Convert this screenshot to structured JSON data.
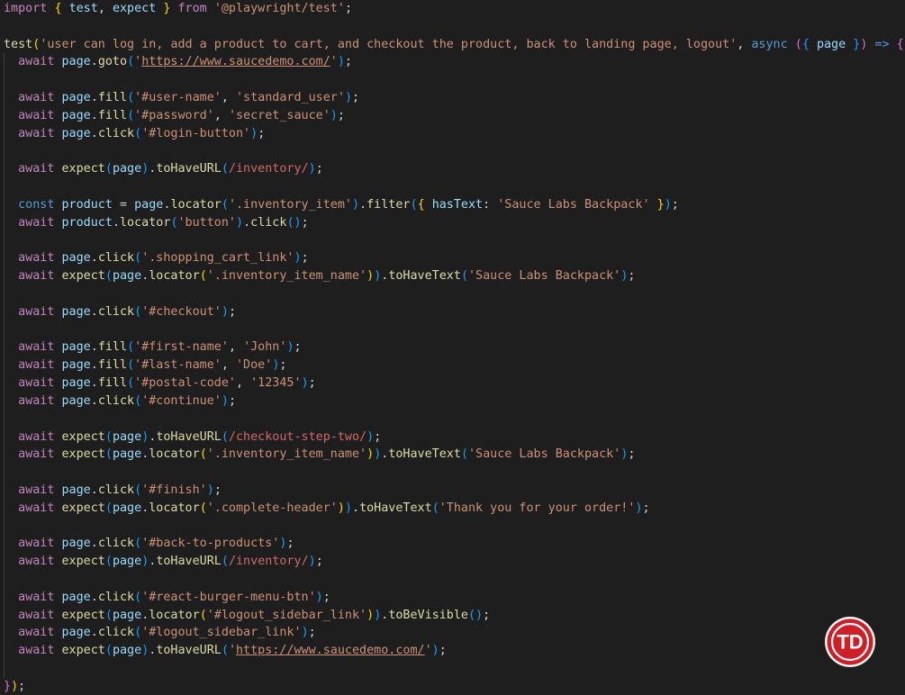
{
  "editor": {
    "colors": {
      "background": "#1e1e1e",
      "keyword": "#c586c0",
      "declaration": "#569cd6",
      "function": "#dcdcaa",
      "variable": "#9cdcfe",
      "string": "#ce9178",
      "regex": "#d16969",
      "punctuation": "#d4d4d4",
      "bracket_level1": "#ffd700",
      "bracket_level2": "#da70d6",
      "bracket_level3": "#179fff"
    },
    "lines": [
      [
        [
          "kw",
          "import"
        ],
        [
          "p",
          " "
        ],
        [
          "b1",
          "{"
        ],
        [
          "p",
          " "
        ],
        [
          "v",
          "test"
        ],
        [
          "p",
          ", "
        ],
        [
          "v",
          "expect"
        ],
        [
          "p",
          " "
        ],
        [
          "b1",
          "}"
        ],
        [
          "p",
          " "
        ],
        [
          "kw",
          "from"
        ],
        [
          "p",
          " "
        ],
        [
          "s",
          "'@playwright/test'"
        ],
        [
          "p",
          ";"
        ]
      ],
      [],
      [
        [
          "fn",
          "test"
        ],
        [
          "b1",
          "("
        ],
        [
          "s",
          "'user can log in, add a product to cart, and checkout the product, back to landing page, logout'"
        ],
        [
          "p",
          ", "
        ],
        [
          "d",
          "async"
        ],
        [
          "p",
          " "
        ],
        [
          "b2",
          "("
        ],
        [
          "b3",
          "{"
        ],
        [
          "p",
          " "
        ],
        [
          "v",
          "page"
        ],
        [
          "p",
          " "
        ],
        [
          "b3",
          "}"
        ],
        [
          "b2",
          ")"
        ],
        [
          "p",
          " "
        ],
        [
          "d",
          "=>"
        ],
        [
          "p",
          " "
        ],
        [
          "b2",
          "{"
        ]
      ],
      [
        [
          "p",
          "  "
        ],
        [
          "kw",
          "await"
        ],
        [
          "p",
          " "
        ],
        [
          "v",
          "page"
        ],
        [
          "p",
          "."
        ],
        [
          "fn",
          "goto"
        ],
        [
          "b3",
          "("
        ],
        [
          "s",
          "'"
        ],
        [
          "u",
          "https://www.saucedemo.com/"
        ],
        [
          "s",
          "'"
        ],
        [
          "b3",
          ")"
        ],
        [
          "p",
          ";"
        ]
      ],
      [],
      [
        [
          "p",
          "  "
        ],
        [
          "kw",
          "await"
        ],
        [
          "p",
          " "
        ],
        [
          "v",
          "page"
        ],
        [
          "p",
          "."
        ],
        [
          "fn",
          "fill"
        ],
        [
          "b3",
          "("
        ],
        [
          "s",
          "'#user-name'"
        ],
        [
          "p",
          ", "
        ],
        [
          "s",
          "'standard_user'"
        ],
        [
          "b3",
          ")"
        ],
        [
          "p",
          ";"
        ]
      ],
      [
        [
          "p",
          "  "
        ],
        [
          "kw",
          "await"
        ],
        [
          "p",
          " "
        ],
        [
          "v",
          "page"
        ],
        [
          "p",
          "."
        ],
        [
          "fn",
          "fill"
        ],
        [
          "b3",
          "("
        ],
        [
          "s",
          "'#password'"
        ],
        [
          "p",
          ", "
        ],
        [
          "s",
          "'secret_sauce'"
        ],
        [
          "b3",
          ")"
        ],
        [
          "p",
          ";"
        ]
      ],
      [
        [
          "p",
          "  "
        ],
        [
          "kw",
          "await"
        ],
        [
          "p",
          " "
        ],
        [
          "v",
          "page"
        ],
        [
          "p",
          "."
        ],
        [
          "fn",
          "click"
        ],
        [
          "b3",
          "("
        ],
        [
          "s",
          "'#login-button'"
        ],
        [
          "b3",
          ")"
        ],
        [
          "p",
          ";"
        ]
      ],
      [],
      [
        [
          "p",
          "  "
        ],
        [
          "kw",
          "await"
        ],
        [
          "p",
          " "
        ],
        [
          "fn",
          "expect"
        ],
        [
          "b3",
          "("
        ],
        [
          "v",
          "page"
        ],
        [
          "b3",
          ")"
        ],
        [
          "p",
          "."
        ],
        [
          "fn",
          "toHaveURL"
        ],
        [
          "b3",
          "("
        ],
        [
          "r",
          "/inventory/"
        ],
        [
          "b3",
          ")"
        ],
        [
          "p",
          ";"
        ]
      ],
      [],
      [
        [
          "p",
          "  "
        ],
        [
          "d",
          "const"
        ],
        [
          "p",
          " "
        ],
        [
          "v",
          "product"
        ],
        [
          "p",
          " = "
        ],
        [
          "v",
          "page"
        ],
        [
          "p",
          "."
        ],
        [
          "fn",
          "locator"
        ],
        [
          "b3",
          "("
        ],
        [
          "s",
          "'.inventory_item'"
        ],
        [
          "b3",
          ")"
        ],
        [
          "p",
          "."
        ],
        [
          "fn",
          "filter"
        ],
        [
          "b3",
          "("
        ],
        [
          "b1",
          "{"
        ],
        [
          "p",
          " "
        ],
        [
          "v",
          "hasText"
        ],
        [
          "p",
          ": "
        ],
        [
          "s",
          "'Sauce Labs Backpack'"
        ],
        [
          "p",
          " "
        ],
        [
          "b1",
          "}"
        ],
        [
          "b3",
          ")"
        ],
        [
          "p",
          ";"
        ]
      ],
      [
        [
          "p",
          "  "
        ],
        [
          "kw",
          "await"
        ],
        [
          "p",
          " "
        ],
        [
          "v",
          "product"
        ],
        [
          "p",
          "."
        ],
        [
          "fn",
          "locator"
        ],
        [
          "b3",
          "("
        ],
        [
          "s",
          "'button'"
        ],
        [
          "b3",
          ")"
        ],
        [
          "p",
          "."
        ],
        [
          "fn",
          "click"
        ],
        [
          "b3",
          "()"
        ],
        [
          "p",
          ";"
        ]
      ],
      [],
      [
        [
          "p",
          "  "
        ],
        [
          "kw",
          "await"
        ],
        [
          "p",
          " "
        ],
        [
          "v",
          "page"
        ],
        [
          "p",
          "."
        ],
        [
          "fn",
          "click"
        ],
        [
          "b3",
          "("
        ],
        [
          "s",
          "'.shopping_cart_link'"
        ],
        [
          "b3",
          ")"
        ],
        [
          "p",
          ";"
        ]
      ],
      [
        [
          "p",
          "  "
        ],
        [
          "kw",
          "await"
        ],
        [
          "p",
          " "
        ],
        [
          "fn",
          "expect"
        ],
        [
          "b3",
          "("
        ],
        [
          "v",
          "page"
        ],
        [
          "p",
          "."
        ],
        [
          "fn",
          "locator"
        ],
        [
          "b1",
          "("
        ],
        [
          "s",
          "'.inventory_item_name'"
        ],
        [
          "b1",
          ")"
        ],
        [
          "b3",
          ")"
        ],
        [
          "p",
          "."
        ],
        [
          "fn",
          "toHaveText"
        ],
        [
          "b3",
          "("
        ],
        [
          "s",
          "'Sauce Labs Backpack'"
        ],
        [
          "b3",
          ")"
        ],
        [
          "p",
          ";"
        ]
      ],
      [],
      [
        [
          "p",
          "  "
        ],
        [
          "kw",
          "await"
        ],
        [
          "p",
          " "
        ],
        [
          "v",
          "page"
        ],
        [
          "p",
          "."
        ],
        [
          "fn",
          "click"
        ],
        [
          "b3",
          "("
        ],
        [
          "s",
          "'#checkout'"
        ],
        [
          "b3",
          ")"
        ],
        [
          "p",
          ";"
        ]
      ],
      [],
      [
        [
          "p",
          "  "
        ],
        [
          "kw",
          "await"
        ],
        [
          "p",
          " "
        ],
        [
          "v",
          "page"
        ],
        [
          "p",
          "."
        ],
        [
          "fn",
          "fill"
        ],
        [
          "b3",
          "("
        ],
        [
          "s",
          "'#first-name'"
        ],
        [
          "p",
          ", "
        ],
        [
          "s",
          "'John'"
        ],
        [
          "b3",
          ")"
        ],
        [
          "p",
          ";"
        ]
      ],
      [
        [
          "p",
          "  "
        ],
        [
          "kw",
          "await"
        ],
        [
          "p",
          " "
        ],
        [
          "v",
          "page"
        ],
        [
          "p",
          "."
        ],
        [
          "fn",
          "fill"
        ],
        [
          "b3",
          "("
        ],
        [
          "s",
          "'#last-name'"
        ],
        [
          "p",
          ", "
        ],
        [
          "s",
          "'Doe'"
        ],
        [
          "b3",
          ")"
        ],
        [
          "p",
          ";"
        ]
      ],
      [
        [
          "p",
          "  "
        ],
        [
          "kw",
          "await"
        ],
        [
          "p",
          " "
        ],
        [
          "v",
          "page"
        ],
        [
          "p",
          "."
        ],
        [
          "fn",
          "fill"
        ],
        [
          "b3",
          "("
        ],
        [
          "s",
          "'#postal-code'"
        ],
        [
          "p",
          ", "
        ],
        [
          "s",
          "'12345'"
        ],
        [
          "b3",
          ")"
        ],
        [
          "p",
          ";"
        ]
      ],
      [
        [
          "p",
          "  "
        ],
        [
          "kw",
          "await"
        ],
        [
          "p",
          " "
        ],
        [
          "v",
          "page"
        ],
        [
          "p",
          "."
        ],
        [
          "fn",
          "click"
        ],
        [
          "b3",
          "("
        ],
        [
          "s",
          "'#continue'"
        ],
        [
          "b3",
          ")"
        ],
        [
          "p",
          ";"
        ]
      ],
      [],
      [
        [
          "p",
          "  "
        ],
        [
          "kw",
          "await"
        ],
        [
          "p",
          " "
        ],
        [
          "fn",
          "expect"
        ],
        [
          "b3",
          "("
        ],
        [
          "v",
          "page"
        ],
        [
          "b3",
          ")"
        ],
        [
          "p",
          "."
        ],
        [
          "fn",
          "toHaveURL"
        ],
        [
          "b3",
          "("
        ],
        [
          "r",
          "/checkout-step-two/"
        ],
        [
          "b3",
          ")"
        ],
        [
          "p",
          ";"
        ]
      ],
      [
        [
          "p",
          "  "
        ],
        [
          "kw",
          "await"
        ],
        [
          "p",
          " "
        ],
        [
          "fn",
          "expect"
        ],
        [
          "b3",
          "("
        ],
        [
          "v",
          "page"
        ],
        [
          "p",
          "."
        ],
        [
          "fn",
          "locator"
        ],
        [
          "b1",
          "("
        ],
        [
          "s",
          "'.inventory_item_name'"
        ],
        [
          "b1",
          ")"
        ],
        [
          "b3",
          ")"
        ],
        [
          "p",
          "."
        ],
        [
          "fn",
          "toHaveText"
        ],
        [
          "b3",
          "("
        ],
        [
          "s",
          "'Sauce Labs Backpack'"
        ],
        [
          "b3",
          ")"
        ],
        [
          "p",
          ";"
        ]
      ],
      [],
      [
        [
          "p",
          "  "
        ],
        [
          "kw",
          "await"
        ],
        [
          "p",
          " "
        ],
        [
          "v",
          "page"
        ],
        [
          "p",
          "."
        ],
        [
          "fn",
          "click"
        ],
        [
          "b3",
          "("
        ],
        [
          "s",
          "'#finish'"
        ],
        [
          "b3",
          ")"
        ],
        [
          "p",
          ";"
        ]
      ],
      [
        [
          "p",
          "  "
        ],
        [
          "kw",
          "await"
        ],
        [
          "p",
          " "
        ],
        [
          "fn",
          "expect"
        ],
        [
          "b3",
          "("
        ],
        [
          "v",
          "page"
        ],
        [
          "p",
          "."
        ],
        [
          "fn",
          "locator"
        ],
        [
          "b1",
          "("
        ],
        [
          "s",
          "'.complete-header'"
        ],
        [
          "b1",
          ")"
        ],
        [
          "b3",
          ")"
        ],
        [
          "p",
          "."
        ],
        [
          "fn",
          "toHaveText"
        ],
        [
          "b3",
          "("
        ],
        [
          "s",
          "'Thank you for your order!'"
        ],
        [
          "b3",
          ")"
        ],
        [
          "p",
          ";"
        ]
      ],
      [],
      [
        [
          "p",
          "  "
        ],
        [
          "kw",
          "await"
        ],
        [
          "p",
          " "
        ],
        [
          "v",
          "page"
        ],
        [
          "p",
          "."
        ],
        [
          "fn",
          "click"
        ],
        [
          "b3",
          "("
        ],
        [
          "s",
          "'#back-to-products'"
        ],
        [
          "b3",
          ")"
        ],
        [
          "p",
          ";"
        ]
      ],
      [
        [
          "p",
          "  "
        ],
        [
          "kw",
          "await"
        ],
        [
          "p",
          " "
        ],
        [
          "fn",
          "expect"
        ],
        [
          "b3",
          "("
        ],
        [
          "v",
          "page"
        ],
        [
          "b3",
          ")"
        ],
        [
          "p",
          "."
        ],
        [
          "fn",
          "toHaveURL"
        ],
        [
          "b3",
          "("
        ],
        [
          "r",
          "/inventory/"
        ],
        [
          "b3",
          ")"
        ],
        [
          "p",
          ";"
        ]
      ],
      [],
      [
        [
          "p",
          "  "
        ],
        [
          "kw",
          "await"
        ],
        [
          "p",
          " "
        ],
        [
          "v",
          "page"
        ],
        [
          "p",
          "."
        ],
        [
          "fn",
          "click"
        ],
        [
          "b3",
          "("
        ],
        [
          "s",
          "'#react-burger-menu-btn'"
        ],
        [
          "b3",
          ")"
        ],
        [
          "p",
          ";"
        ]
      ],
      [
        [
          "p",
          "  "
        ],
        [
          "kw",
          "await"
        ],
        [
          "p",
          " "
        ],
        [
          "fn",
          "expect"
        ],
        [
          "b3",
          "("
        ],
        [
          "v",
          "page"
        ],
        [
          "p",
          "."
        ],
        [
          "fn",
          "locator"
        ],
        [
          "b1",
          "("
        ],
        [
          "s",
          "'#logout_sidebar_link'"
        ],
        [
          "b1",
          ")"
        ],
        [
          "b3",
          ")"
        ],
        [
          "p",
          "."
        ],
        [
          "fn",
          "toBeVisible"
        ],
        [
          "b3",
          "()"
        ],
        [
          "p",
          ";"
        ]
      ],
      [
        [
          "p",
          "  "
        ],
        [
          "kw",
          "await"
        ],
        [
          "p",
          " "
        ],
        [
          "v",
          "page"
        ],
        [
          "p",
          "."
        ],
        [
          "fn",
          "click"
        ],
        [
          "b3",
          "("
        ],
        [
          "s",
          "'#logout_sidebar_link'"
        ],
        [
          "b3",
          ")"
        ],
        [
          "p",
          ";"
        ]
      ],
      [
        [
          "p",
          "  "
        ],
        [
          "kw",
          "await"
        ],
        [
          "p",
          " "
        ],
        [
          "fn",
          "expect"
        ],
        [
          "b3",
          "("
        ],
        [
          "v",
          "page"
        ],
        [
          "b3",
          ")"
        ],
        [
          "p",
          "."
        ],
        [
          "fn",
          "toHaveURL"
        ],
        [
          "b3",
          "("
        ],
        [
          "s",
          "'"
        ],
        [
          "u",
          "https://www.saucedemo.com/"
        ],
        [
          "s",
          "'"
        ],
        [
          "b3",
          ")"
        ],
        [
          "p",
          ";"
        ]
      ],
      [],
      [
        [
          "b2",
          "}"
        ],
        [
          "b1",
          ")"
        ],
        [
          "p",
          ";"
        ]
      ]
    ]
  },
  "logo": {
    "text": "TD",
    "fill": "#cc1f27",
    "ring": "#ffffff",
    "text_color": "#ffffff"
  }
}
